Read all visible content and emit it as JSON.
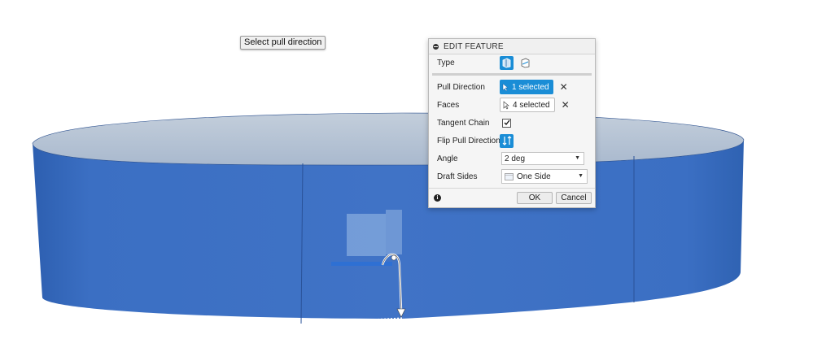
{
  "viewport": {
    "tooltip": "Select pull direction",
    "body_color": "#3f74c6",
    "top_face_color": "#b6c4d6"
  },
  "dialog": {
    "title": "EDIT FEATURE",
    "rows": {
      "type": {
        "label": "Type"
      },
      "pull_direction": {
        "label": "Pull Direction",
        "value": "1 selected"
      },
      "faces": {
        "label": "Faces",
        "value": "4 selected"
      },
      "tangent_chain": {
        "label": "Tangent Chain",
        "checked": true
      },
      "flip_pull_direction": {
        "label": "Flip Pull Direction"
      },
      "angle": {
        "label": "Angle",
        "value": "2 deg"
      },
      "draft_sides": {
        "label": "Draft Sides",
        "value": "One Side"
      }
    },
    "ok": "OK",
    "cancel": "Cancel"
  },
  "colors": {
    "accent": "#1a8dd6"
  }
}
